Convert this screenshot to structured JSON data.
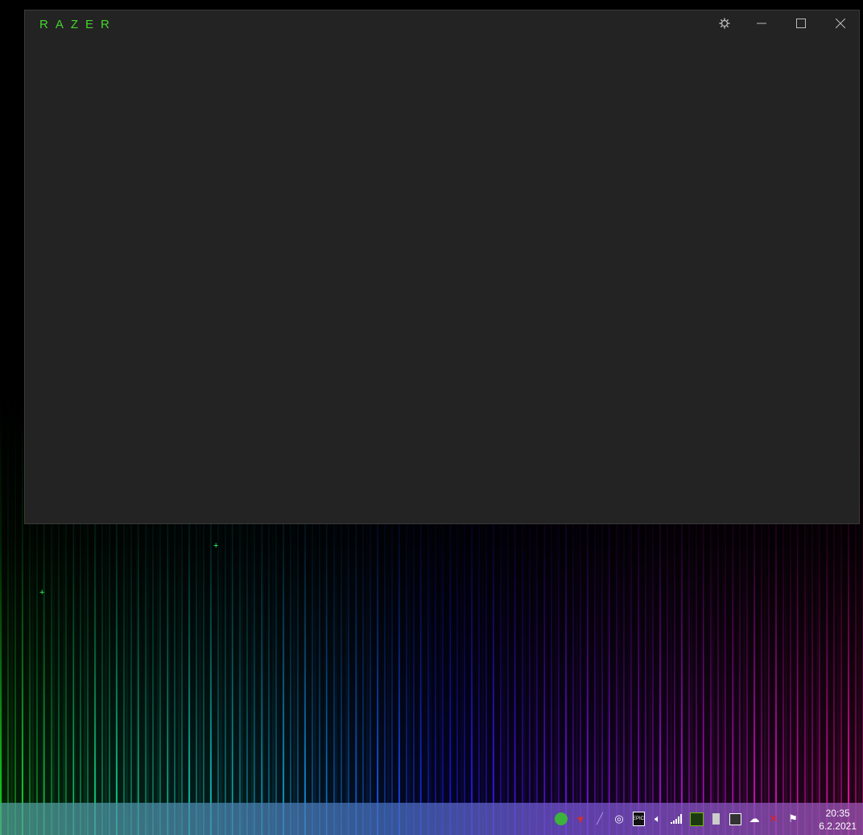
{
  "window": {
    "logo": "RAZER",
    "controls": {
      "settings": "settings-icon",
      "minimize": "minimize-icon",
      "maximize": "maximize-icon",
      "close": "close-icon"
    },
    "brand_color": "#44d62c",
    "background": "#232323"
  },
  "taskbar": {
    "tray_icons": [
      "razer-synapse-icon",
      "red-app-icon",
      "feather-app-icon",
      "steelseries-icon",
      "epic-games-icon",
      "volume-icon",
      "network-signal-icon",
      "nvidia-icon",
      "usb-drive-icon",
      "tablet-icon",
      "onedrive-warning-icon",
      "power-error-icon",
      "action-center-flag-icon"
    ],
    "clock": {
      "time": "20:35",
      "date": "6.2.2021"
    }
  }
}
